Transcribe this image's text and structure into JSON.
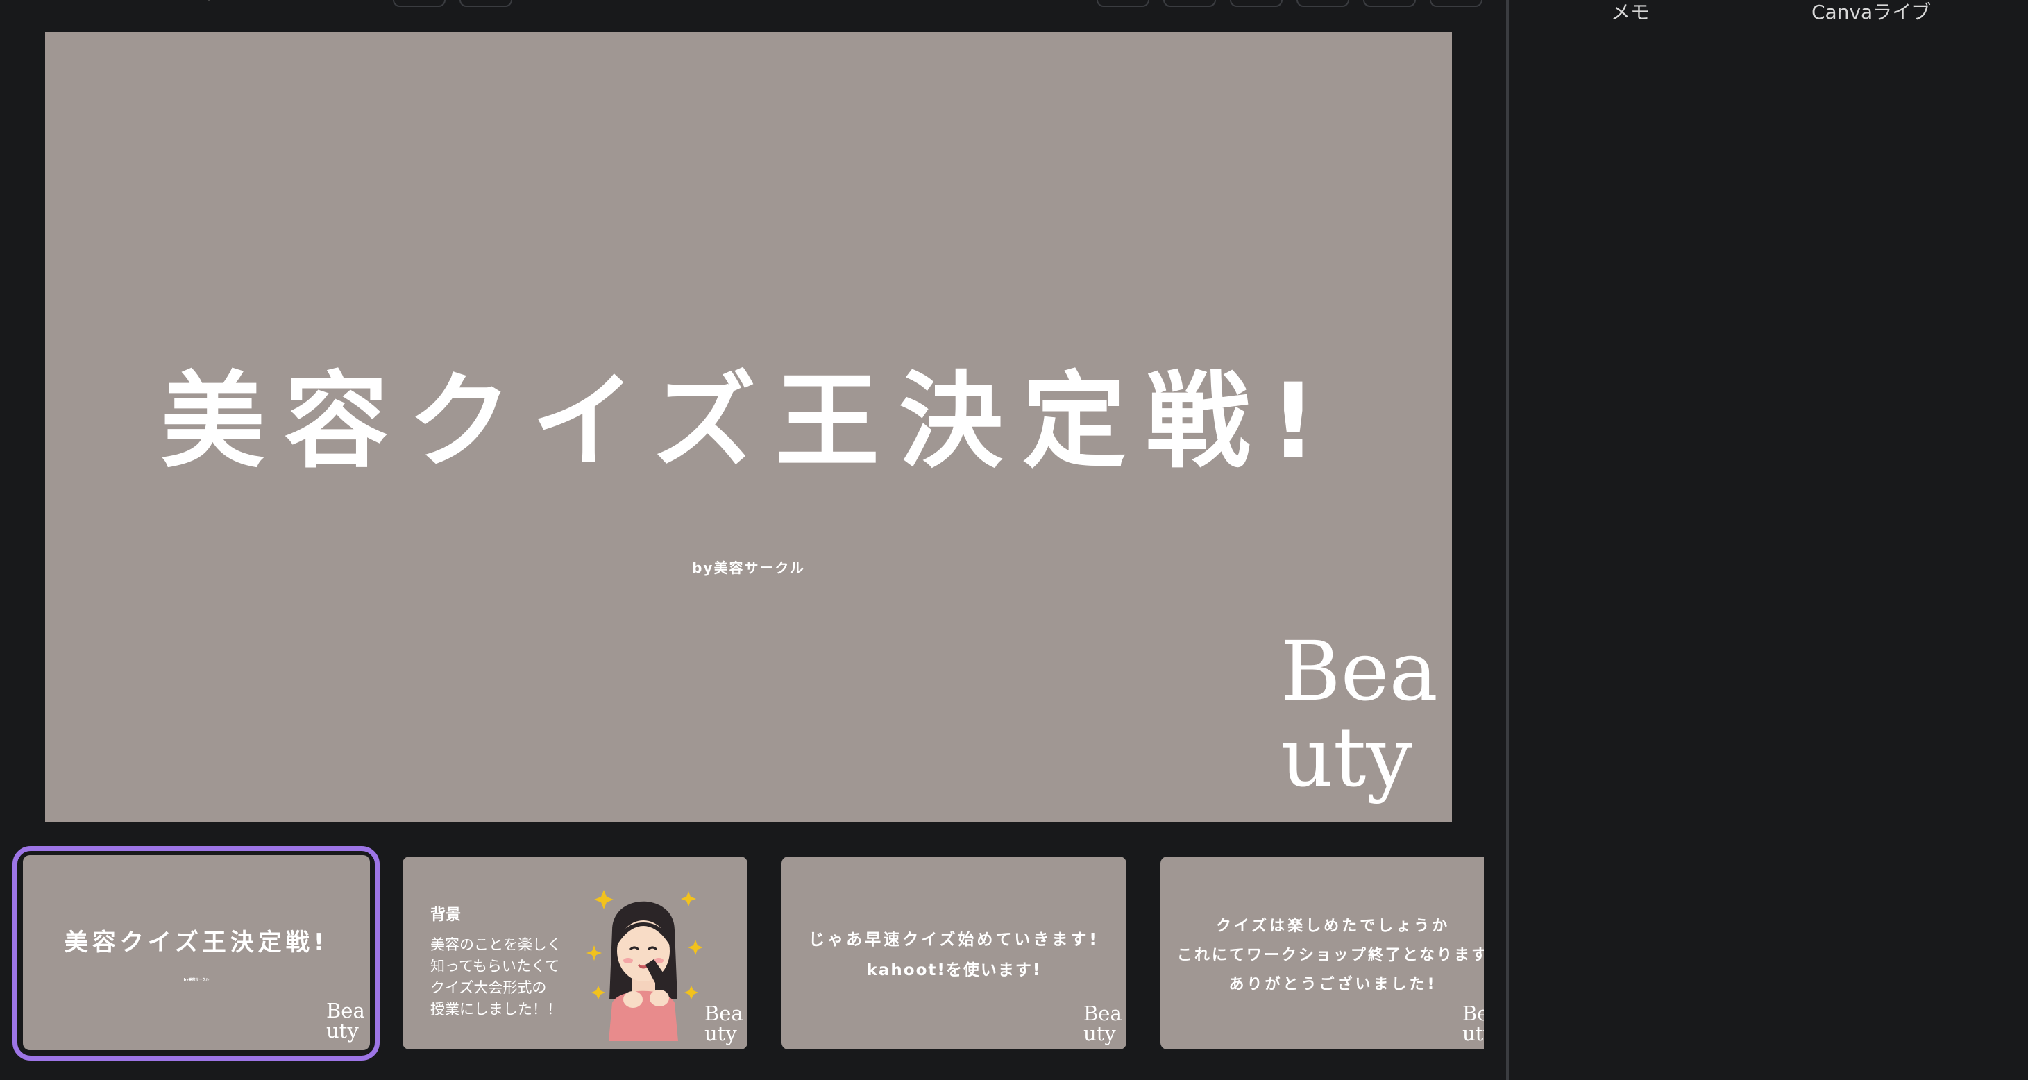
{
  "main_slide": {
    "title": "美容クイズ王決定戦!",
    "subtitle": "by美容サークル",
    "logo_line1": "Bea",
    "logo_line2": "uty"
  },
  "right_panel": {
    "tabs": [
      {
        "label": "メモ"
      },
      {
        "label": "Canvaライブ"
      }
    ]
  },
  "thumbnails": [
    {
      "title": "美容クイズ王決定戦!",
      "subtitle": "by美容サークル",
      "logo_line1": "Bea",
      "logo_line2": "uty",
      "selected": true
    },
    {
      "heading": "背景",
      "body": [
        "美容のことを楽しく",
        "知ってもらいたくて",
        "クイズ大会形式の",
        "授業にしました！！"
      ],
      "logo_line1": "Bea",
      "logo_line2": "uty"
    },
    {
      "lines": [
        "じゃあ早速クイズ始めていきます!",
        "kahoot!を使います!"
      ],
      "logo_line1": "Bea",
      "logo_line2": "uty"
    },
    {
      "lines": [
        "クイズは楽しめたでしょうか",
        "これにてワークショップ終了となります",
        "ありがとうございました!"
      ],
      "logo_line1": "Bea",
      "logo_line2": "uty"
    }
  ],
  "colors": {
    "background": "#18191b",
    "slide": "#a09793",
    "selection": "#9d75e6"
  }
}
